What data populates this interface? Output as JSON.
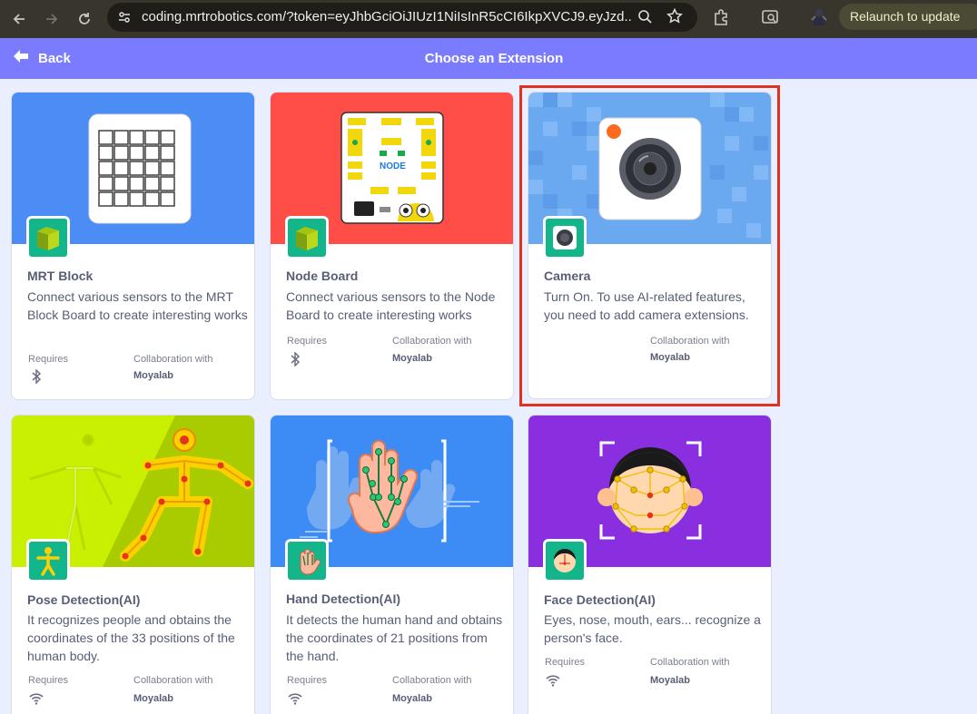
{
  "browser": {
    "url": "coding.mrtrobotics.com/?token=eyJhbGciOiJIUzI1NiIsInR5cCI6IkpXVCJ9.eyJzd...",
    "relaunch_label": "Relaunch to update"
  },
  "header": {
    "back_label": "Back",
    "title": "Choose an Extension"
  },
  "cards": [
    {
      "title": "MRT Block",
      "description": "Connect various sensors to the MRT Block Board to create interesting works",
      "requires_label": "Requires",
      "requires_icon": "bluetooth-icon",
      "collab_label": "Collaboration with",
      "collab_value": "Moyalab",
      "hero_color": "#4c8cf5"
    },
    {
      "title": "Node Board",
      "description": "Connect various sensors to the Node Board to create interesting works",
      "requires_label": "Requires",
      "requires_icon": "bluetooth-icon",
      "collab_label": "Collaboration with",
      "collab_value": "Moyalab",
      "hero_color": "#ff4d48",
      "board_label": "NODE"
    },
    {
      "title": "Camera",
      "description": "Turn On. To use AI-related features, you need to add camera extensions.",
      "collab_label": "Collaboration with",
      "collab_value": "Moyalab",
      "hero_color": "#6aa8f0"
    },
    {
      "title": "Pose Detection(AI)",
      "description": "It recognizes people and obtains the coordinates of the 33 positions of the human body.",
      "requires_label": "Requires",
      "requires_icon": "wifi-icon",
      "collab_label": "Collaboration with",
      "collab_value": "Moyalab",
      "hero_color": "#c8f000"
    },
    {
      "title": "Hand Detection(AI)",
      "description": "It detects the human hand and obtains the coordinates of 21 positions from the hand.",
      "requires_label": "Requires",
      "requires_icon": "wifi-icon",
      "collab_label": "Collaboration with",
      "collab_value": "Moyalab",
      "hero_color": "#3d8cf5"
    },
    {
      "title": "Face Detection(AI)",
      "description": "Eyes, nose, mouth, ears... recognize a person's face.",
      "requires_label": "Requires",
      "requires_icon": "wifi-icon",
      "collab_label": "Collaboration with",
      "collab_value": "Moyalab",
      "hero_color": "#8a2fe0"
    }
  ],
  "colors": {
    "header": "#7b7bff",
    "page_bg": "#e9efff",
    "highlight": "#e0321f",
    "text": "#575e75"
  }
}
